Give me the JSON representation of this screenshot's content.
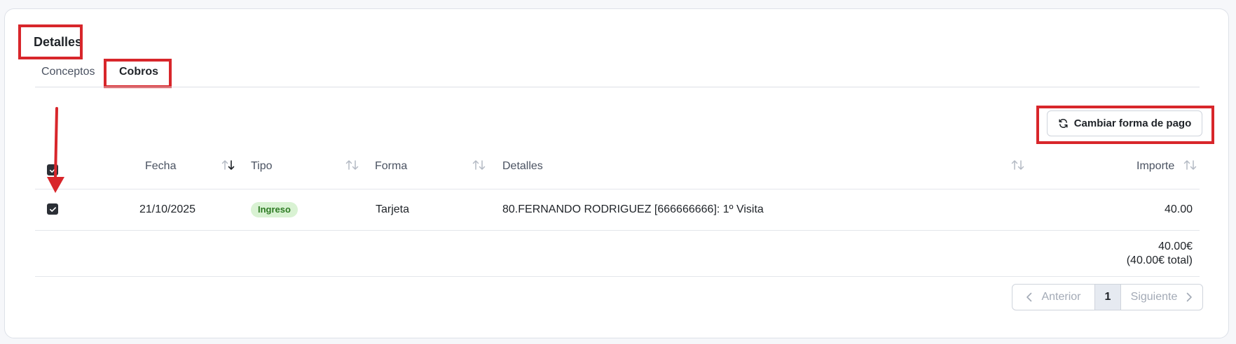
{
  "section": {
    "title": "Detalles"
  },
  "tabs": [
    {
      "label": "Conceptos",
      "active": false
    },
    {
      "label": "Cobros",
      "active": true
    }
  ],
  "toolbar": {
    "change_payment_label": "Cambiar forma de pago",
    "icon": "refresh-icon"
  },
  "table": {
    "header_checkbox_checked": true,
    "columns": [
      "Fecha",
      "Tipo",
      "Forma",
      "Detalles",
      "Importe"
    ],
    "rows": [
      {
        "checked": true,
        "fecha": "21/10/2025",
        "tipo": "Ingreso",
        "forma": "Tarjeta",
        "detalles": "80.FERNANDO RODRIGUEZ [666666666]: 1º Visita",
        "importe": "40.00"
      }
    ],
    "total": "40.00€",
    "total_note": "(40.00€ total)"
  },
  "pagination": {
    "prev_label": "Anterior",
    "current_page": "1",
    "next_label": "Siguiente"
  },
  "colors": {
    "highlight": "#d8262b",
    "badge_bg": "#d9f2d3",
    "badge_text": "#2c7a22",
    "checkbox": "#2b2f36"
  }
}
